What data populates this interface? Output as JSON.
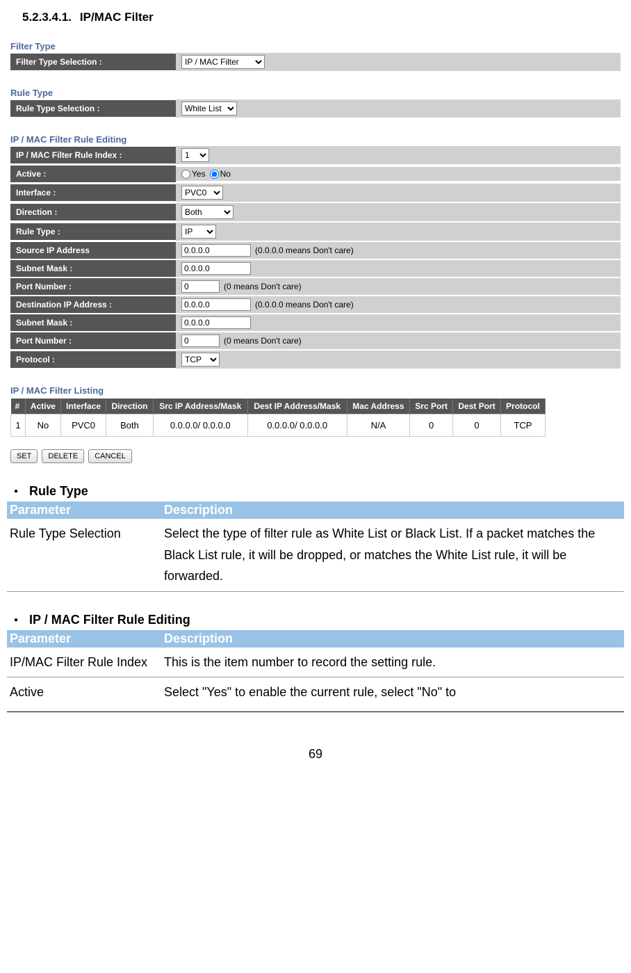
{
  "heading": {
    "number": "5.2.3.4.1.",
    "title": "IP/MAC Filter"
  },
  "filterType": {
    "section": "Filter Type",
    "label": "Filter Type Selection :",
    "value": "IP / MAC Filter"
  },
  "ruleType": {
    "section": "Rule Type",
    "label": "Rule Type Selection :",
    "value": "White List"
  },
  "editing": {
    "section": "IP / MAC Filter Rule Editing",
    "rows": {
      "index": {
        "label": "IP / MAC Filter Rule Index :",
        "value": "1"
      },
      "active": {
        "label": "Active :",
        "yes": "Yes",
        "no": "No"
      },
      "interface": {
        "label": "Interface :",
        "value": "PVC0"
      },
      "direction": {
        "label": "Direction :",
        "value": "Both"
      },
      "ruletype": {
        "label": "Rule Type :",
        "value": "IP"
      },
      "srcip": {
        "label": "Source IP Address",
        "value": "0.0.0.0",
        "hint": "(0.0.0.0 means Don't care)"
      },
      "srcmask": {
        "label": "Subnet Mask :",
        "value": "0.0.0.0"
      },
      "srcport": {
        "label": "Port Number :",
        "value": "0",
        "hint": "(0 means Don't care)"
      },
      "dstip": {
        "label": "Destination IP Address :",
        "value": "0.0.0.0",
        "hint": "(0.0.0.0 means Don't care)"
      },
      "dstmask": {
        "label": "Subnet Mask :",
        "value": "0.0.0.0"
      },
      "dstport": {
        "label": "Port Number :",
        "value": "0",
        "hint": "(0 means Don't care)"
      },
      "protocol": {
        "label": "Protocol :",
        "value": "TCP"
      }
    }
  },
  "listing": {
    "section": "IP / MAC Filter Listing",
    "headers": [
      "#",
      "Active",
      "Interface",
      "Direction",
      "Src IP Address/Mask",
      "Dest IP Address/Mask",
      "Mac Address",
      "Src Port",
      "Dest Port",
      "Protocol"
    ],
    "row": [
      "1",
      "No",
      "PVC0",
      "Both",
      "0.0.0.0/ 0.0.0.0",
      "0.0.0.0/ 0.0.0.0",
      "N/A",
      "0",
      "0",
      "TCP"
    ]
  },
  "buttons": {
    "set": "SET",
    "delete": "DELETE",
    "cancel": "CANCEL"
  },
  "doc1": {
    "bullet": "Rule Type",
    "hparam": "Parameter",
    "hdesc": "Description",
    "p1": "Rule Type Selection",
    "d1": "Select the type of filter rule as White List or Black List. If a packet matches the Black List rule, it will be dropped, or matches the White List rule, it will be forwarded."
  },
  "doc2": {
    "bullet": "IP / MAC Filter Rule Editing",
    "hparam": "Parameter",
    "hdesc": "Description",
    "p1": "IP/MAC Filter Rule Index",
    "d1": "This is the item number to record the setting rule.",
    "p2": "Active",
    "d2": "Select \"Yes\" to enable the current rule, select \"No\" to"
  },
  "pagenum": "69"
}
